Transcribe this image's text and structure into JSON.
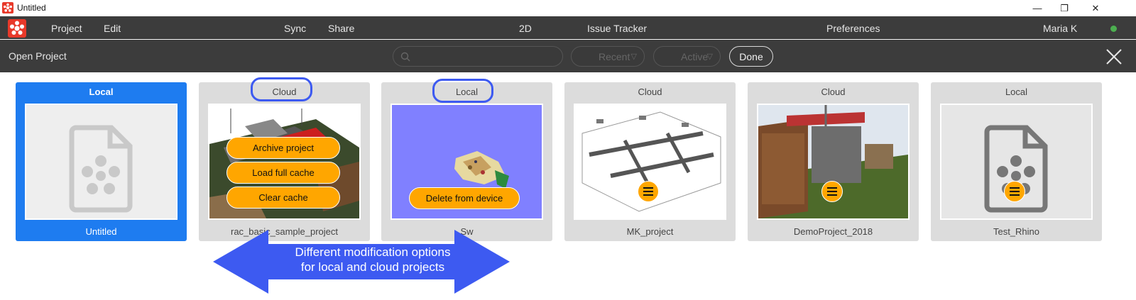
{
  "window": {
    "title": "Untitled",
    "minimize": "—",
    "restore": "❐",
    "close": "✕"
  },
  "menubar": {
    "items": [
      {
        "label": "Project"
      },
      {
        "label": "Edit"
      },
      {
        "label": "Sync"
      },
      {
        "label": "Share"
      },
      {
        "label": "2D"
      },
      {
        "label": "Issue Tracker"
      },
      {
        "label": "Preferences"
      }
    ],
    "user_name": "Maria K",
    "status_color": "#4caf50"
  },
  "toolbar": {
    "title": "Open Project",
    "search_placeholder": "",
    "filter_recent": "Recent",
    "filter_active": "Active",
    "done_label": "Done",
    "close_icon": "close-icon"
  },
  "projects": [
    {
      "badge": "Local",
      "name": "Untitled",
      "selected": true,
      "thumbnail": "file-placeholder-icon"
    },
    {
      "badge": "Cloud",
      "name": "rac_basic_sample_project",
      "selected": false,
      "thumbnail": "house-model",
      "actions": [
        "Archive project",
        "Load full cache",
        "Clear cache"
      ]
    },
    {
      "badge": "Local",
      "name": "Sw",
      "selected": false,
      "thumbnail": "terrain-model",
      "actions": [
        "Delete from device"
      ]
    },
    {
      "badge": "Cloud",
      "name": "MK_project",
      "selected": false,
      "thumbnail": "mep-model"
    },
    {
      "badge": "Cloud",
      "name": "DemoProject_2018",
      "selected": false,
      "thumbnail": "building-render"
    },
    {
      "badge": "Local",
      "name": "Test_Rhino",
      "selected": false,
      "thumbnail": "file-placeholder-icon"
    }
  ],
  "annotation": {
    "line1": "Different modification options",
    "line2": "for local and cloud projects",
    "color": "#3d5af1"
  },
  "colors": {
    "accent": "#1e7cf0",
    "action": "#ffa600",
    "bar": "#3c3c3c"
  }
}
